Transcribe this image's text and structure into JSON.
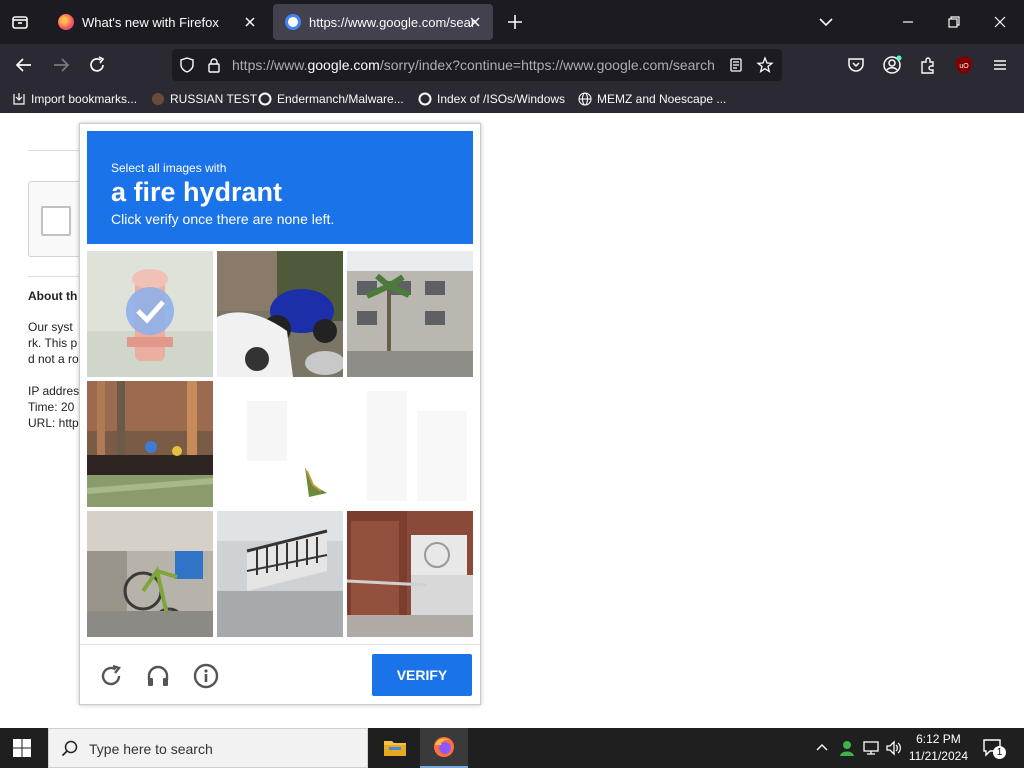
{
  "browser": {
    "tabs": [
      {
        "title": "What's new with Firefox"
      },
      {
        "title": "https://www.google.com/search"
      }
    ],
    "url": {
      "prefix": "https://www.",
      "domain": "google.com",
      "rest": "/sorry/index?continue=https://www.google.com/search"
    },
    "bookmarks": [
      {
        "label": "Import bookmarks..."
      },
      {
        "label": "RUSSIAN TEST"
      },
      {
        "label": "Endermanch/Malware..."
      },
      {
        "label": "Index of /ISOs/Windows"
      },
      {
        "label": "MEMZ and Noescape ..."
      }
    ]
  },
  "page": {
    "about_heading": "About th",
    "lines": [
      "Our syst",
      "rk. This p",
      "d not a ro",
      "IP addres",
      "Time: 20",
      "URL: http"
    ]
  },
  "challenge": {
    "prompt_small": "Select all images with",
    "prompt_big": "a fire hydrant",
    "prompt_sub": "Click verify once there are none left.",
    "verify_label": "VERIFY",
    "tiles": [
      {
        "id": "tile-1",
        "content": "fire-hydrant",
        "selected": true
      },
      {
        "id": "tile-2",
        "content": "motorcycle-and-car",
        "selected": false
      },
      {
        "id": "tile-3",
        "content": "building-with-palm",
        "selected": false
      },
      {
        "id": "tile-4",
        "content": "playground",
        "selected": false
      },
      {
        "id": "tile-5",
        "content": "loading-blank",
        "selected": false
      },
      {
        "id": "tile-6",
        "content": "building",
        "selected": false
      },
      {
        "id": "tile-7",
        "content": "bicycle",
        "selected": false
      },
      {
        "id": "tile-8",
        "content": "balcony-railing",
        "selected": false
      },
      {
        "id": "tile-9",
        "content": "red-doors-ac",
        "selected": false
      }
    ]
  },
  "taskbar": {
    "search_placeholder": "Type here to search",
    "time": "6:12 PM",
    "date": "11/21/2024",
    "notification_count": "1"
  },
  "colors": {
    "accent": "#1a73e8",
    "tabbar": "#1c1b22",
    "toolbar": "#2b2a33"
  }
}
